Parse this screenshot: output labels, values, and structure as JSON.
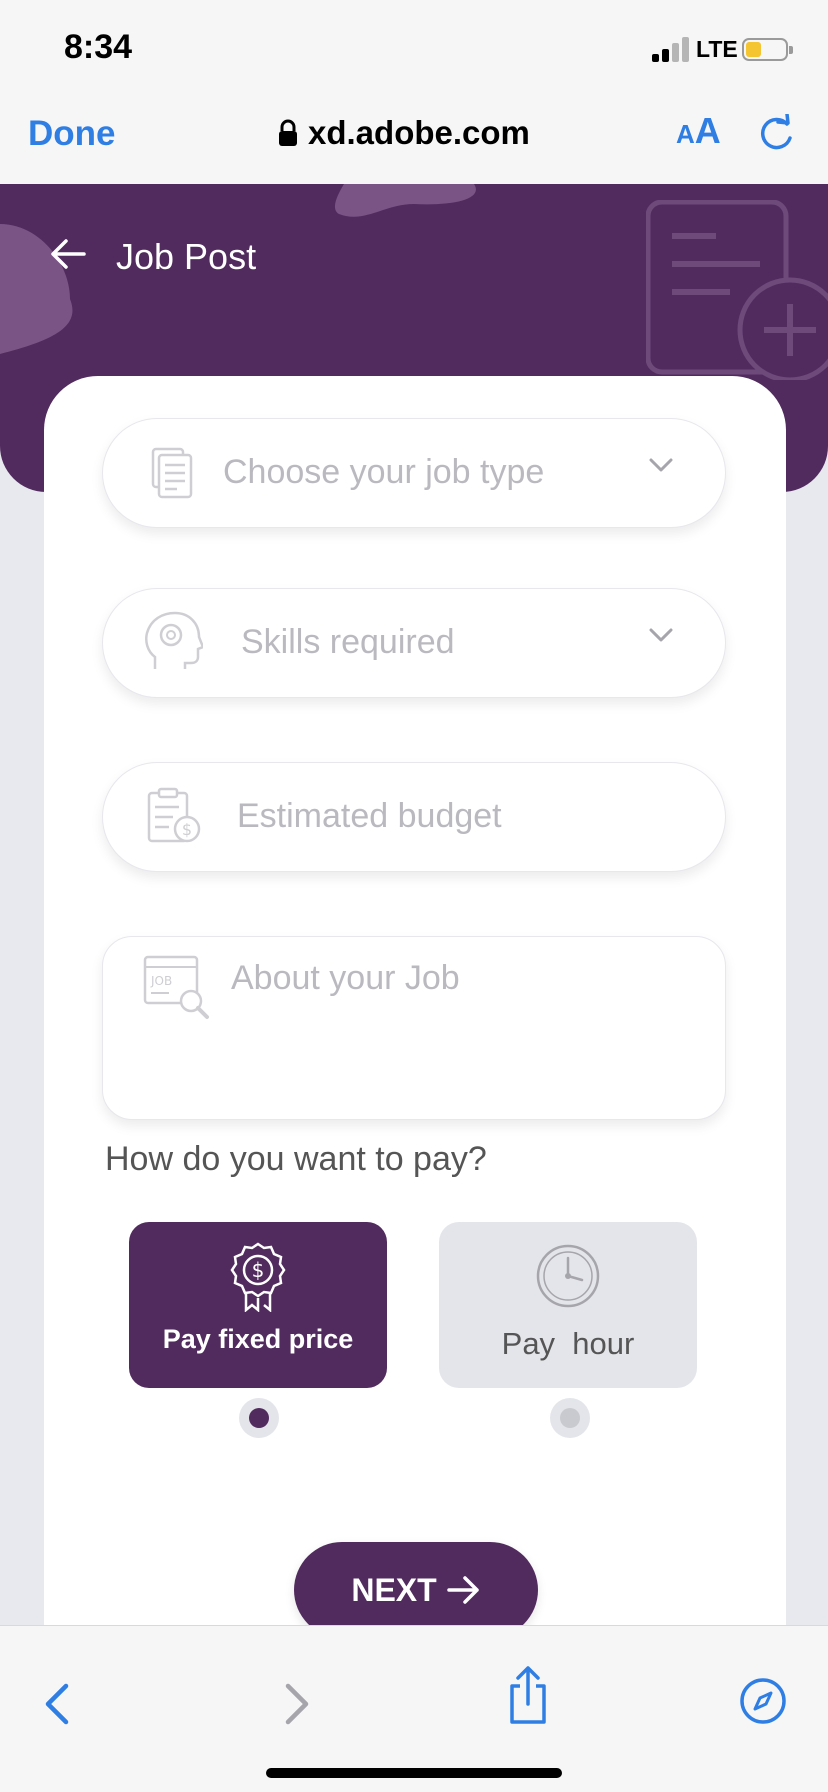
{
  "status_bar": {
    "time": "8:34",
    "network": "LTE",
    "battery_color": "#f4c431"
  },
  "safari": {
    "done_label": "Done",
    "url": "xd.adobe.com",
    "text_size_small": "A",
    "text_size_large": "A",
    "accent": "#2f7ee4"
  },
  "header": {
    "title": "Job Post"
  },
  "form": {
    "job_type": {
      "placeholder": "Choose your job type",
      "icon": "document-icon"
    },
    "skills": {
      "placeholder": "Skills required",
      "icon": "head-gear-icon"
    },
    "budget": {
      "placeholder": "Estimated budget",
      "icon": "clipboard-dollar-icon"
    },
    "about": {
      "placeholder": "About your Job",
      "icon": "job-search-icon"
    }
  },
  "payment": {
    "question": "How do you want to pay?",
    "options": [
      {
        "label": "Pay fixed price",
        "icon": "dollar-badge-icon",
        "selected": true
      },
      {
        "label": "Pay  hour",
        "icon": "clock-icon",
        "selected": false
      }
    ]
  },
  "next_label": "NEXT",
  "colors": {
    "brand": "#512b5e",
    "placeholder": "#b9b9bf",
    "muted_card": "#e4e5ea"
  }
}
